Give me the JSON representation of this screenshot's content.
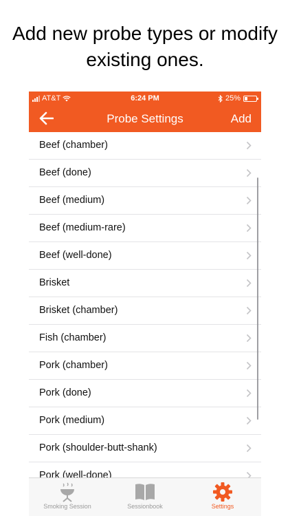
{
  "headline": "Add new probe types or modify existing ones.",
  "status_bar": {
    "carrier": "AT&T",
    "time": "6:24 PM",
    "battery": "25%",
    "battery_level": 0.25
  },
  "nav": {
    "title": "Probe Settings",
    "add_label": "Add"
  },
  "probe_list": [
    "Beef (chamber)",
    "Beef (done)",
    "Beef (medium)",
    "Beef (medium-rare)",
    "Beef (well-done)",
    "Brisket",
    "Brisket (chamber)",
    "Fish (chamber)",
    "Pork (chamber)",
    "Pork (done)",
    "Pork (medium)",
    "Pork (shoulder-butt-shank)",
    "Pork (well-done)"
  ],
  "tabs": [
    {
      "label": "Smoking Session",
      "icon": "grill-icon",
      "active": false
    },
    {
      "label": "Sessionbook",
      "icon": "book-icon",
      "active": false
    },
    {
      "label": "Settings",
      "icon": "gear-icon",
      "active": true
    }
  ],
  "colors": {
    "accent": "#f15a22",
    "tab_inactive": "#9a9a9a"
  }
}
